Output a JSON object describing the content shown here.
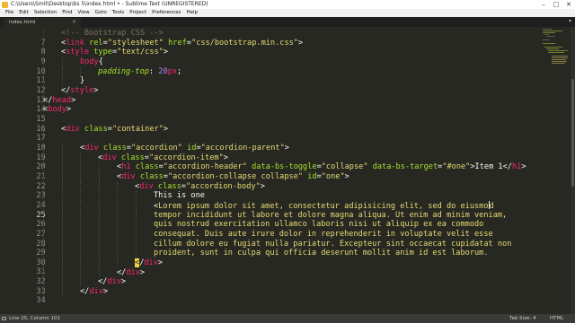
{
  "window": {
    "title": "C:\\Users\\Smit\\Desktop\\bs 5\\index.html • - Sublime Text (UNREGISTERED)",
    "minimize": "–",
    "maximize": "□",
    "close": "✕"
  },
  "menu": [
    "File",
    "Edit",
    "Selection",
    "Find",
    "View",
    "Goto",
    "Tools",
    "Project",
    "Preferences",
    "Help"
  ],
  "tab": {
    "label": "index.html",
    "close": "×",
    "overflow": "▾"
  },
  "gutter": [
    "7",
    "8",
    "9",
    "10",
    "11",
    "12",
    "13",
    "14",
    "15",
    "16",
    "17",
    "18",
    "19",
    "20",
    "21",
    "22",
    "23",
    "24",
    "25",
    "26",
    "27",
    "28",
    "29",
    "30",
    "31",
    "32",
    "33",
    "34"
  ],
  "code": {
    "l7": [
      "<!-- Bootstrap CSS -->"
    ],
    "l8": [
      "<",
      "link",
      " ",
      "rel",
      "=",
      "\"stylesheet\"",
      " ",
      "href",
      "=",
      "\"css/bootstrap.min.css\"",
      ">"
    ],
    "l9": [
      "<",
      "style",
      " ",
      "type",
      "=",
      "\"text/css\"",
      ">"
    ],
    "l10": [
      "body",
      "{"
    ],
    "l11": [
      "padding-top",
      ": ",
      "20",
      "px",
      ";"
    ],
    "l12": [
      "}"
    ],
    "l13": [
      "</",
      "style",
      ">"
    ],
    "l14": [
      "</",
      "head",
      ">"
    ],
    "l15": [
      "<",
      "body",
      ">"
    ],
    "l17": [
      "<",
      "div",
      " ",
      "class",
      "=",
      "\"container\"",
      ">"
    ],
    "l19": [
      "<",
      "div",
      " ",
      "class",
      "=",
      "\"accordion\"",
      " ",
      "id",
      "=",
      "\"accordion-parent\"",
      ">"
    ],
    "l20": [
      "<",
      "div",
      " ",
      "class",
      "=",
      "\"accordion-item\"",
      ">"
    ],
    "l21": [
      "<",
      "h1",
      " ",
      "class",
      "=",
      "\"accordion-header\"",
      " ",
      "data-bs-toggle",
      "=",
      "\"collapse\"",
      " ",
      "data-bs-target",
      "=",
      "\"#one\"",
      ">",
      "Item 1",
      "</",
      "h1",
      ">"
    ],
    "l22": [
      "<",
      "div",
      " ",
      "class",
      "=",
      "\"accordion-collapse collapse\"",
      " ",
      "id",
      "=",
      "\"one\"",
      ">"
    ],
    "l23": [
      "<",
      "div",
      " ",
      "class",
      "=",
      "\"accordion-body\"",
      ">"
    ],
    "l24": [
      "This is one"
    ],
    "l25": [
      "<",
      "Lorem ipsum dolor sit amet, consectetur adipisicing elit, sed do eiusmo",
      "d"
    ],
    "l26": [
      "tempor incididunt ut labore et dolore magna aliqua. Ut enim ad minim veniam,"
    ],
    "l27": [
      "quis nostrud exercitation ullamco laboris nisi ut aliquip ex ea commodo"
    ],
    "l28": [
      "consequat. Duis aute irure dolor in reprehenderit in voluptate velit esse"
    ],
    "l29": [
      "cillum dolore eu fugiat nulla pariatur. Excepteur sint occaecat cupidatat non"
    ],
    "l30": [
      "proident, sunt in culpa qui officia deserunt mollit anim id est laborum."
    ],
    "l31": [
      "<",
      "/",
      "div",
      ">"
    ],
    "l32": [
      "</",
      "div",
      ">"
    ],
    "l33": [
      "</",
      "div",
      ">"
    ],
    "l34": [
      "</",
      "div",
      ">"
    ]
  },
  "status": {
    "position": "Line 25, Column 101",
    "tab_size": "Tab Size: 4",
    "syntax": "HTML"
  },
  "colors": {
    "background": "#272822",
    "tag": "#f92672",
    "attribute": "#a6e22e",
    "string": "#e6db74",
    "comment": "#75715e",
    "number": "#ae81ff"
  }
}
